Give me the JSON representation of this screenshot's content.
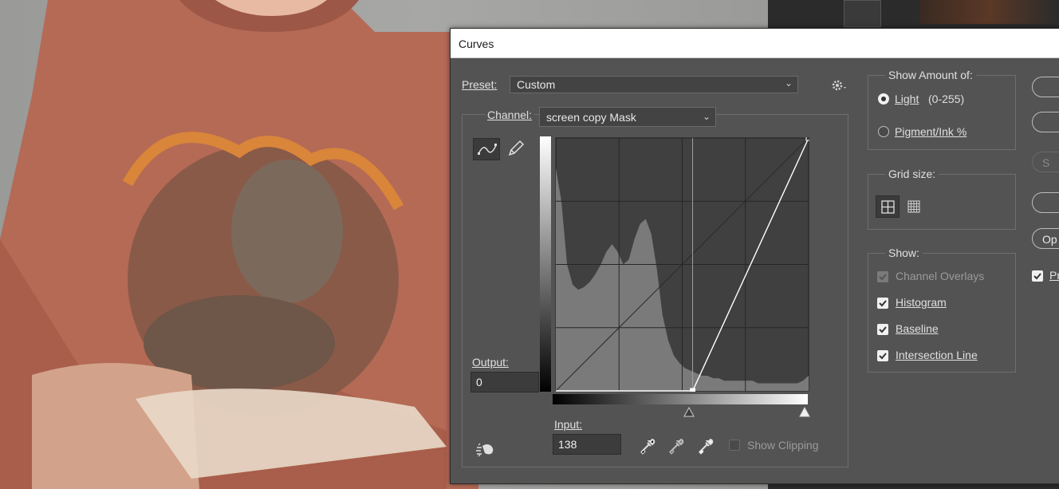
{
  "dialog": {
    "title": "Curves"
  },
  "preset": {
    "label": "Preset:",
    "value": "Custom"
  },
  "channel": {
    "label": "Channel:",
    "value": "screen copy Mask"
  },
  "output": {
    "label": "Output:",
    "value": "0"
  },
  "input": {
    "label": "Input:",
    "value": "138"
  },
  "show_clipping": {
    "label": "Show Clipping",
    "checked": false
  },
  "show_amount": {
    "title": "Show Amount of:",
    "options": [
      {
        "label": "Light",
        "suffix": "(0-255)",
        "selected": true
      },
      {
        "label": "Pigment/Ink %",
        "selected": false
      }
    ]
  },
  "grid_size": {
    "title": "Grid size:",
    "options": [
      "simple-grid",
      "detailed-grid"
    ],
    "selected": "simple-grid"
  },
  "show": {
    "title": "Show:",
    "items": [
      {
        "label": "Channel Overlays",
        "checked": true,
        "disabled": true
      },
      {
        "label": "Histogram",
        "checked": true,
        "disabled": false
      },
      {
        "label": "Baseline",
        "checked": true,
        "disabled": false
      },
      {
        "label": "Intersection Line",
        "checked": true,
        "disabled": false
      }
    ]
  },
  "side_buttons": {
    "options_partial": "Op",
    "preview_partial": "Pr",
    "smooth_partial": "S"
  },
  "curve": {
    "points": [
      {
        "input": 138,
        "output": 0
      },
      {
        "input": 255,
        "output": 255
      }
    ]
  },
  "histogram": {
    "values": [
      88,
      75,
      50,
      42,
      40,
      41,
      43,
      46,
      50,
      55,
      58,
      55,
      50,
      52,
      60,
      66,
      68,
      62,
      48,
      30,
      20,
      14,
      11,
      9,
      8,
      7,
      6,
      6,
      5,
      5,
      4,
      4,
      4,
      4,
      4,
      4,
      3,
      3,
      3,
      3,
      3,
      3,
      3,
      3,
      4,
      6
    ]
  },
  "colors": {
    "dialog_bg": "#535353",
    "graph_bg": "#404040",
    "histogram": "#7a7a7a",
    "curve": "#ffffff"
  }
}
